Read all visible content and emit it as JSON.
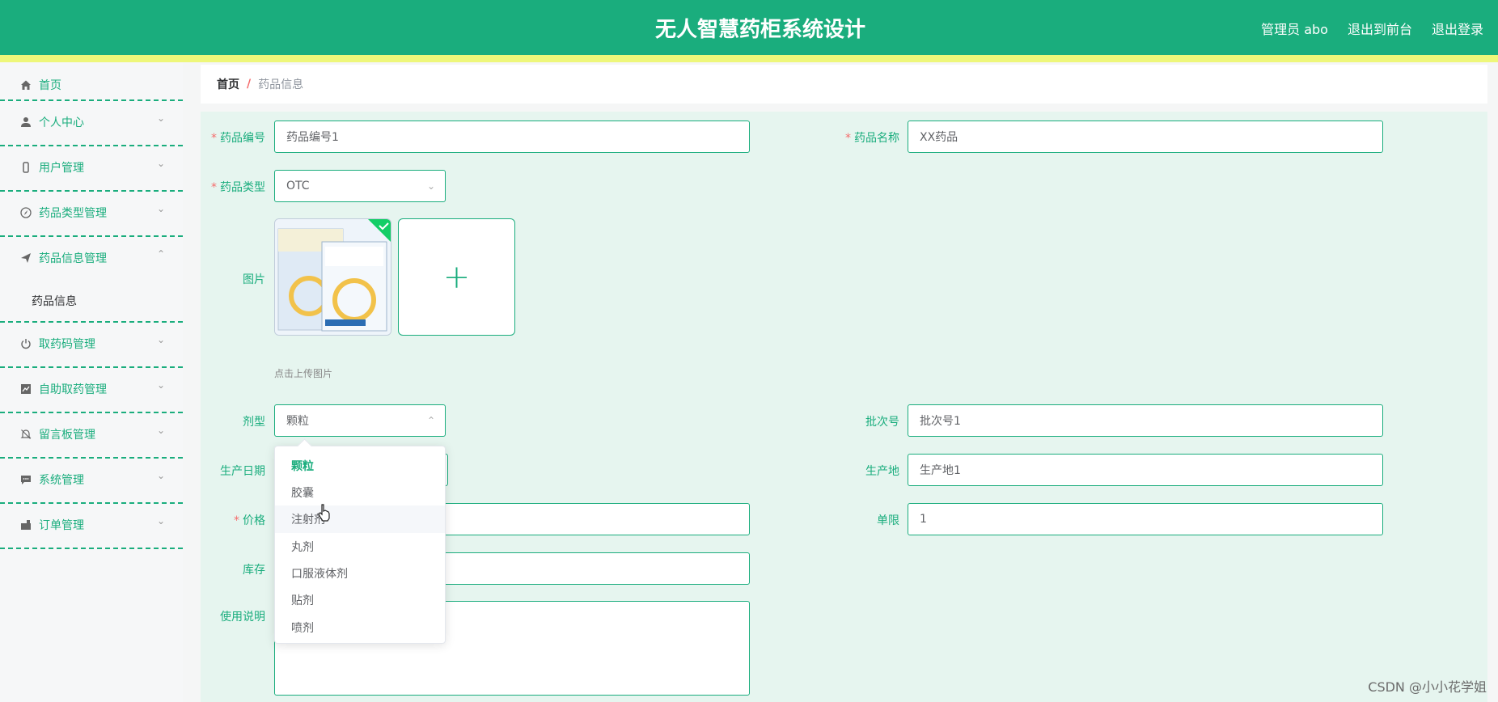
{
  "header": {
    "title": "无人智慧药柜系统设计",
    "admin_label": "管理员 abo",
    "back_to_front": "退出到前台",
    "logout": "退出登录"
  },
  "sidebar": {
    "items": [
      {
        "label": "首页",
        "icon": "home-icon"
      },
      {
        "label": "个人中心",
        "icon": "user-icon"
      },
      {
        "label": "用户管理",
        "icon": "phone-icon"
      },
      {
        "label": "药品类型管理",
        "icon": "compass-icon"
      },
      {
        "label": "药品信息管理",
        "icon": "send-icon"
      },
      {
        "label": "取药码管理",
        "icon": "power-icon"
      },
      {
        "label": "自助取药管理",
        "icon": "chart-icon"
      },
      {
        "label": "留言板管理",
        "icon": "bell-off-icon"
      },
      {
        "label": "系统管理",
        "icon": "message-icon"
      },
      {
        "label": "订单管理",
        "icon": "cart-icon"
      }
    ],
    "subitem": "药品信息"
  },
  "breadcrumb": {
    "home": "首页",
    "separator": "/",
    "current": "药品信息"
  },
  "form": {
    "code_label": "药品编号",
    "code_value": "药品编号1",
    "name_label": "药品名称",
    "name_value": "XX药品",
    "type_label": "药品类型",
    "type_value": "OTC",
    "image_label": "图片",
    "upload_tip": "点击上传图片",
    "dosage_label": "剂型",
    "dosage_value": "颗粒",
    "batch_label": "批次号",
    "batch_value": "批次号1",
    "prod_date_label": "生产日期",
    "origin_label": "生产地",
    "origin_value": "生产地1",
    "price_label": "价格",
    "limit_label": "单限",
    "limit_value": "1",
    "stock_label": "库存",
    "instructions_label": "使用说明"
  },
  "dosage_options": [
    "颗粒",
    "胶囊",
    "注射剂",
    "丸剂",
    "口服液体剂",
    "贴剂",
    "喷剂"
  ],
  "watermark": "CSDN @小小花学姐",
  "colors": {
    "accent": "#1aad7d",
    "strip": "#eef77a",
    "required": "#f56c6c",
    "form_bg": "#e6f5ef"
  }
}
